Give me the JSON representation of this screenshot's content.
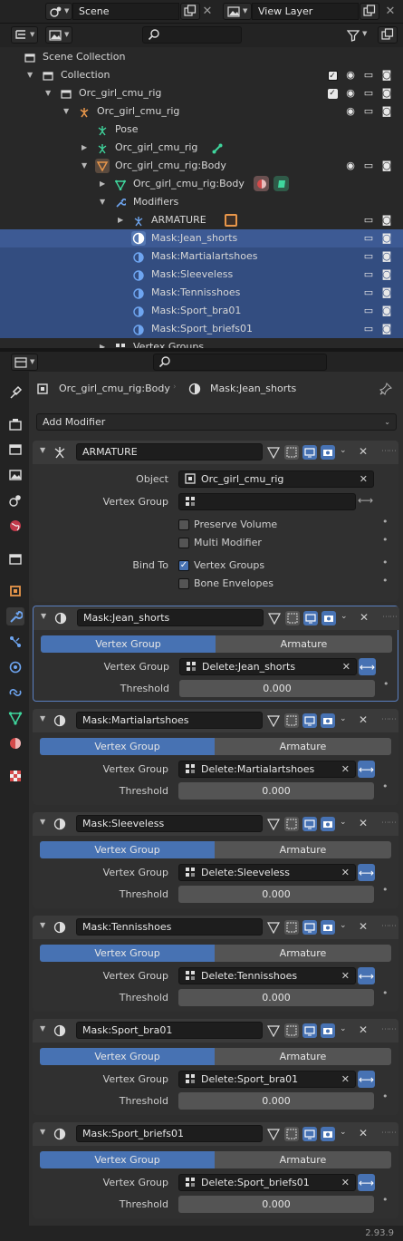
{
  "topbar": {
    "scene_label": "Scene",
    "view_layer_label": "View Layer"
  },
  "outliner": {
    "rows": [
      {
        "label": "Scene Collection"
      },
      {
        "label": "Collection"
      },
      {
        "label": "Orc_girl_cmu_rig"
      },
      {
        "label": "Orc_girl_cmu_rig"
      },
      {
        "label": "Pose"
      },
      {
        "label": "Orc_girl_cmu_rig"
      },
      {
        "label": "Orc_girl_cmu_rig:Body"
      },
      {
        "label": "Orc_girl_cmu_rig:Body"
      },
      {
        "label": "Modifiers"
      },
      {
        "label": "ARMATURE"
      },
      {
        "label": "Mask:Jean_shorts"
      },
      {
        "label": "Mask:Martialartshoes"
      },
      {
        "label": "Mask:Sleeveless"
      },
      {
        "label": "Mask:Tennisshoes"
      },
      {
        "label": "Mask:Sport_bra01"
      },
      {
        "label": "Mask:Sport_briefs01"
      },
      {
        "label": "Vertex Groups"
      }
    ]
  },
  "properties": {
    "breadcrumb_object": "Orc_girl_cmu_rig:Body",
    "breadcrumb_modifier": "Mask:Jean_shorts",
    "add_modifier": "Add Modifier",
    "armature": {
      "name": "ARMATURE",
      "object_label": "Object",
      "object_value": "Orc_girl_cmu_rig",
      "vgroup_label": "Vertex Group",
      "vgroup_value": "",
      "preserve_volume": "Preserve Volume",
      "multi_modifier": "Multi Modifier",
      "bind_to_label": "Bind To",
      "bind_vertex_groups": "Vertex Groups",
      "bind_bone_envelopes": "Bone Envelopes"
    },
    "mode_vertex_group": "Vertex Group",
    "mode_armature": "Armature",
    "vgroup_label": "Vertex Group",
    "threshold_label": "Threshold",
    "masks": [
      {
        "name": "Mask:Jean_shorts",
        "vgroup": "Delete:Jean_shorts",
        "threshold": "0.000"
      },
      {
        "name": "Mask:Martialartshoes",
        "vgroup": "Delete:Martialartshoes",
        "threshold": "0.000"
      },
      {
        "name": "Mask:Sleeveless",
        "vgroup": "Delete:Sleeveless",
        "threshold": "0.000"
      },
      {
        "name": "Mask:Tennisshoes",
        "vgroup": "Delete:Tennisshoes",
        "threshold": "0.000"
      },
      {
        "name": "Mask:Sport_bra01",
        "vgroup": "Delete:Sport_bra01",
        "threshold": "0.000"
      },
      {
        "name": "Mask:Sport_briefs01",
        "vgroup": "Delete:Sport_briefs01",
        "threshold": "0.000"
      }
    ]
  },
  "status": {
    "version": "2.93.9"
  },
  "colors": {
    "accent": "#4772b3",
    "selection": "#334d80",
    "object_orange": "#e8964a",
    "mesh_green": "#3fd69d",
    "modifier_blue": "#6ea5f0"
  }
}
